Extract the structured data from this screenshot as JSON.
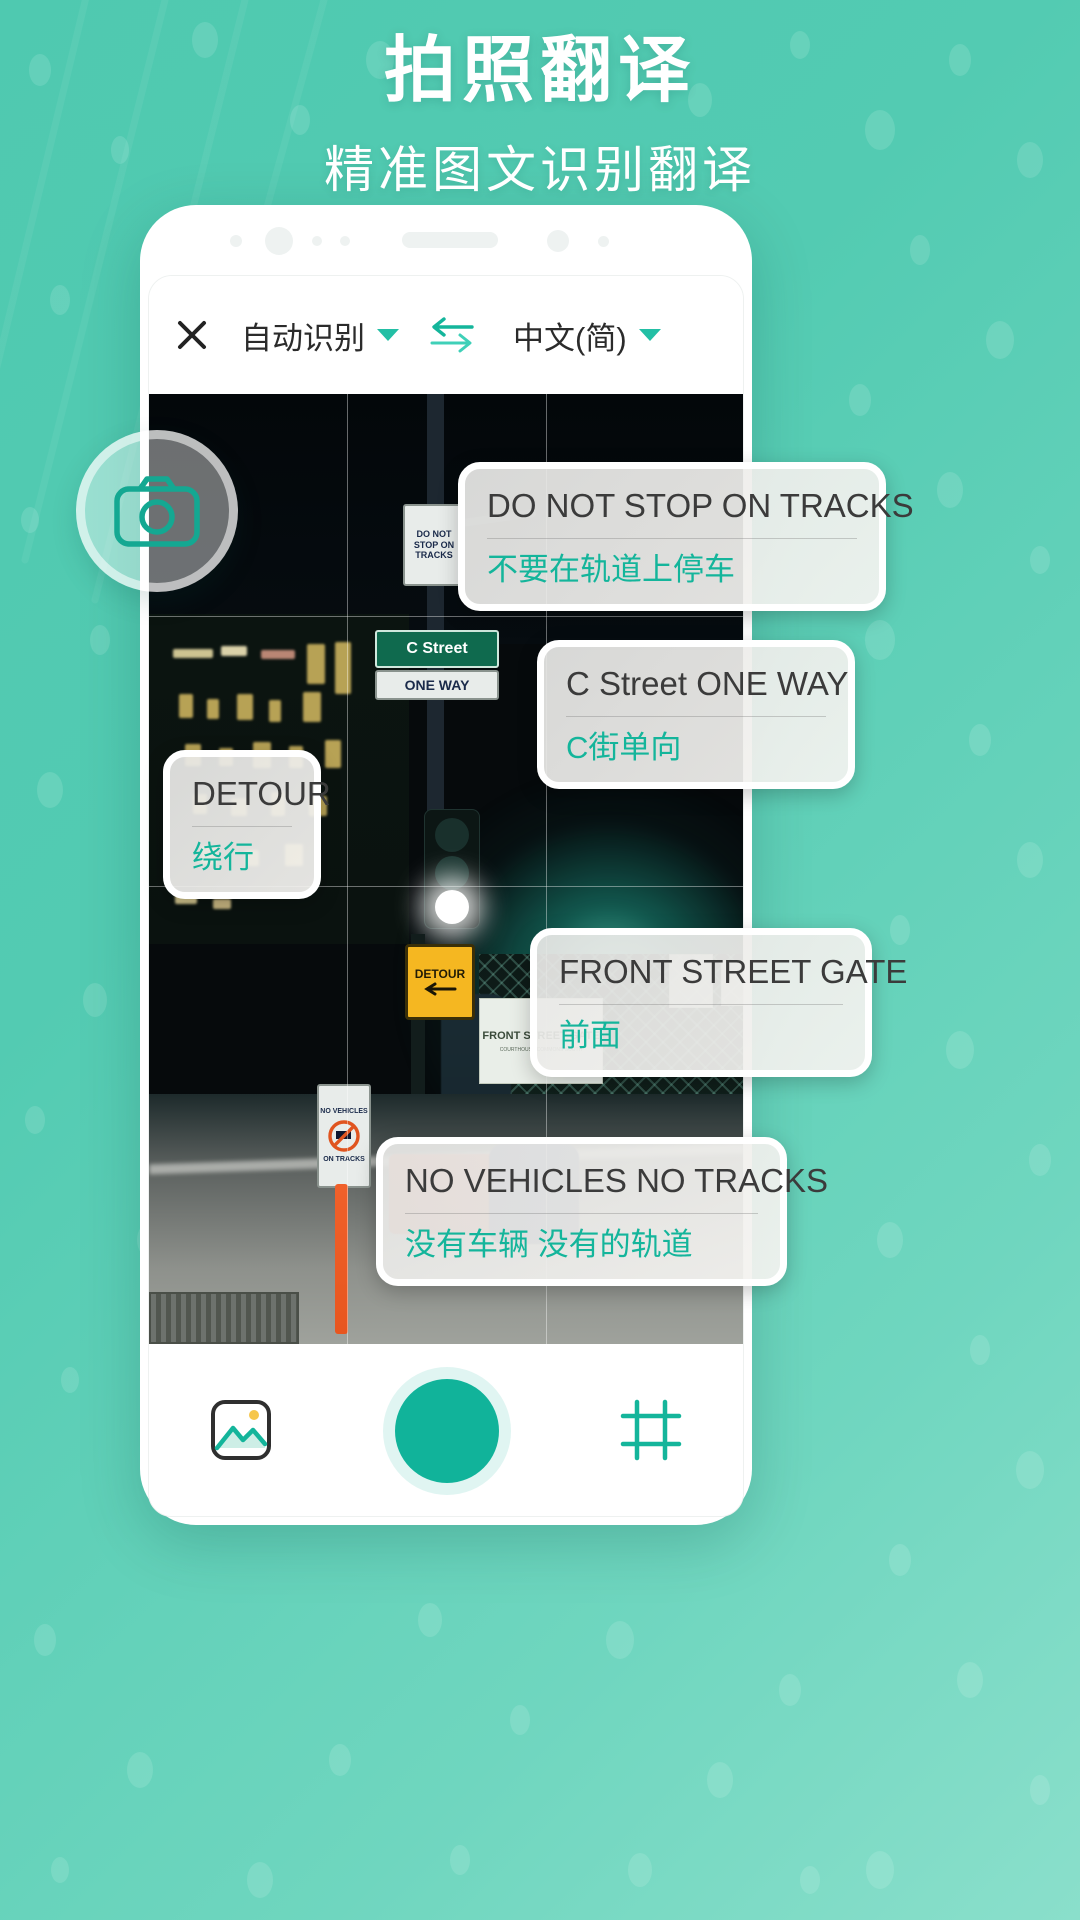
{
  "theme": {
    "brand_teal": "#11b39a",
    "bg_green": "#53cbb2",
    "card_text": "#3b3b3b",
    "translation_text": "#14b59b"
  },
  "headings": {
    "title": "拍照翻译",
    "subtitle": "精准图文识别翻译"
  },
  "toolbar": {
    "close_icon": "close-icon",
    "source_language": "自动识别",
    "source_caret": "chevron-down-icon",
    "swap_icon": "swap-arrows-icon",
    "target_language": "中文(简)",
    "target_caret": "chevron-down-icon"
  },
  "camera_badge": {
    "icon": "camera-icon"
  },
  "translation_cards": [
    {
      "source": "DO NOT STOP ON TRACKS",
      "translation": "不要在轨道上停车"
    },
    {
      "source": "C Street    ONE WAY",
      "translation": "C街单向"
    },
    {
      "source": "DETOUR",
      "translation": "绕行"
    },
    {
      "source": "FRONT STREET GATE",
      "translation": "前面"
    },
    {
      "source": "NO VEHICLES NO TRACKS",
      "translation": "没有车辆 没有的轨道"
    }
  ],
  "scene_signs": {
    "do_not_stop": "DO NOT STOP ON TRACKS",
    "c_street": "C Street",
    "one_way": "ONE WAY",
    "detour": "DETOUR",
    "front_street_gate": "FRONT STREET GATE",
    "front_street_gate_sub": "COURTHOUSE COMMONS SOUTH",
    "no_vehicles": "NO VEHICLES",
    "on_tracks": "ON TRACKS"
  },
  "bottom_bar": {
    "gallery_icon": "image-gallery-icon",
    "shutter_icon": "shutter-button",
    "crop_icon": "crop-frame-icon"
  }
}
